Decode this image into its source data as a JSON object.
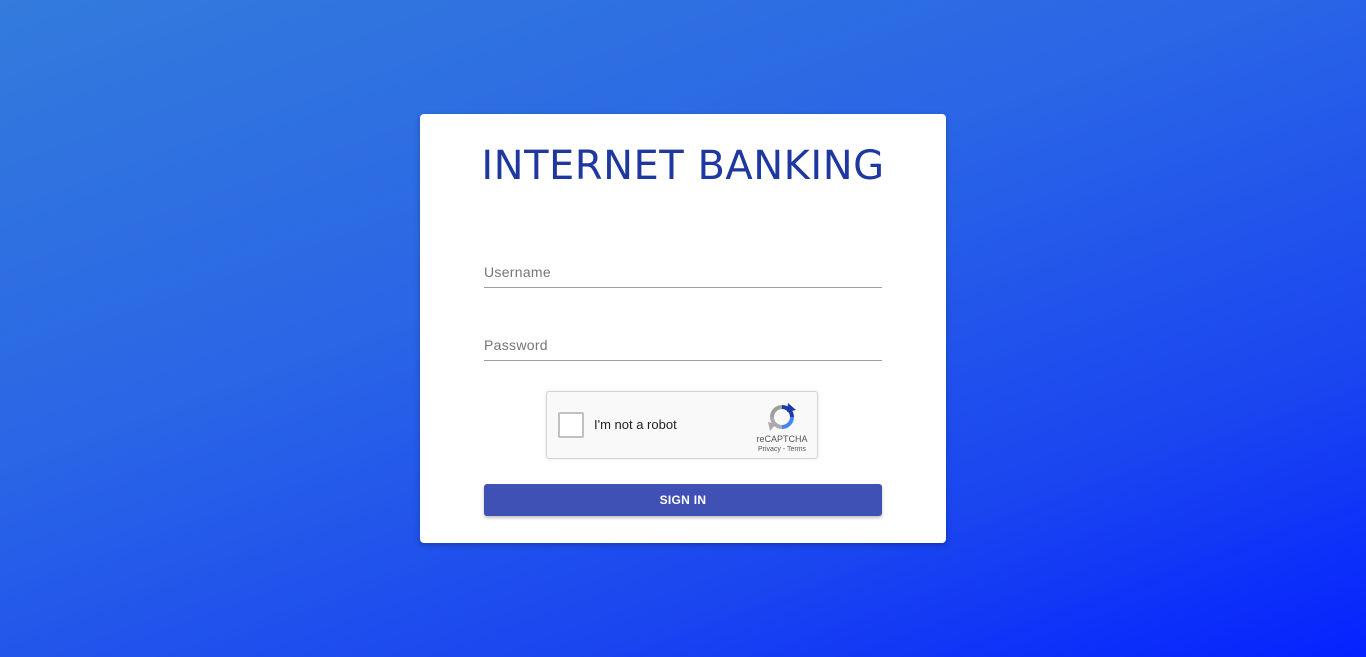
{
  "page": {
    "title": "INTERNET BANKING",
    "background_colors": [
      "#337bdc",
      "#0522ff"
    ],
    "title_color": "#1e38a0"
  },
  "form": {
    "username": {
      "placeholder": "Username",
      "value": ""
    },
    "password": {
      "placeholder": "Password",
      "value": ""
    },
    "submit_label": "SIGN IN",
    "submit_color": "#3f51b5"
  },
  "captcha": {
    "label": "I'm not a robot",
    "checked": false,
    "brand": "reCAPTCHA",
    "privacy_label": "Privacy",
    "separator": " - ",
    "terms_label": "Terms",
    "logo_icon": "recaptcha-logo-icon"
  }
}
